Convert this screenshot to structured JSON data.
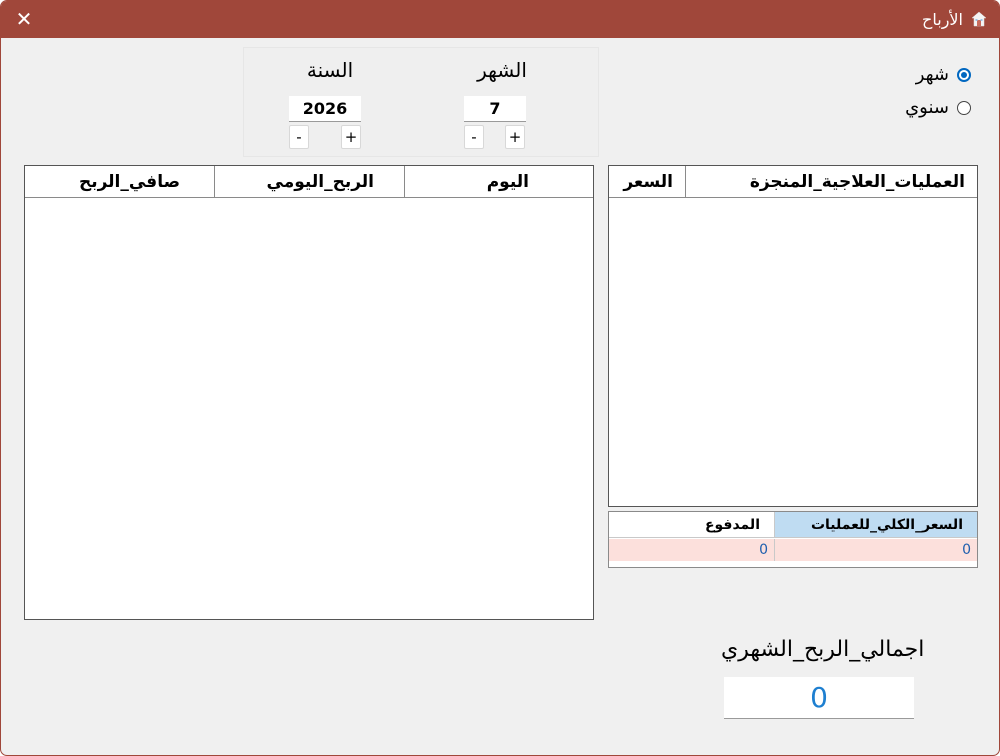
{
  "window": {
    "title": "الأرباح",
    "close_glyph": "✕",
    "title_icon": "house-icon"
  },
  "period": {
    "options": [
      {
        "label": "شهر",
        "checked": true
      },
      {
        "label": "سنوي",
        "checked": false
      }
    ]
  },
  "date": {
    "month_label": "الشهر",
    "month_value": "7",
    "year_label": "السنة",
    "year_value": "2026",
    "minus": "-",
    "plus": "+"
  },
  "treatments_table": {
    "columns": [
      "العمليات_العلاجية_المنجزة",
      "السعر"
    ],
    "rows": []
  },
  "summary": {
    "headers": [
      "السعر_الكلي_للعمليات",
      "المدفوع"
    ],
    "values": [
      "0",
      "0"
    ]
  },
  "profit_table": {
    "columns": [
      "اليوم",
      "الربح_اليومي",
      "صافي_الربح"
    ],
    "rows": []
  },
  "total": {
    "label": "اجمالي_الربح_الشهري",
    "value": "0"
  },
  "colors": {
    "titlebar": "#a0473a",
    "accent": "#0067c0",
    "summary_header_highlight": "#bfdcf2",
    "summary_row": "#fce0dc",
    "total_value": "#1e7fd0"
  }
}
